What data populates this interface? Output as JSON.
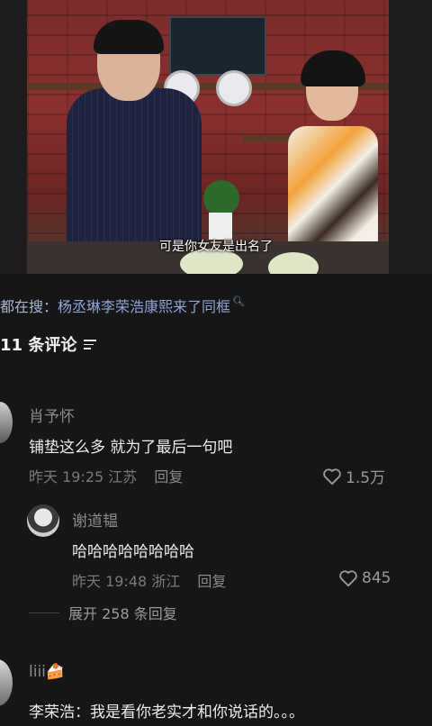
{
  "video": {
    "subtitle": "可是你女友是出名了"
  },
  "search": {
    "prefix": "都在搜：",
    "query": "杨丞琳李荣浩康熙来了同框"
  },
  "comments_header": {
    "count_label": "11 条评论"
  },
  "comments": [
    {
      "username": "肖予怀",
      "text": "铺垫这么多 就为了最后一句吧",
      "time": "昨天 19:25",
      "location": "江苏",
      "reply_label": "回复",
      "likes": "1.5万"
    },
    {
      "username": "谢道韫",
      "text": "哈哈哈哈哈哈哈哈",
      "time": "昨天 19:48",
      "location": "浙江",
      "reply_label": "回复",
      "likes": "845"
    },
    {
      "username": "liii🍰",
      "text": "李荣浩：我是看你老实才和你说话的。。。"
    }
  ],
  "expand": {
    "label": "展开 258 条回复"
  },
  "colors": {
    "background": "#161616",
    "link": "#8ea5d6"
  },
  "icons": [
    "search-icon",
    "sort-icon",
    "heart-icon"
  ]
}
